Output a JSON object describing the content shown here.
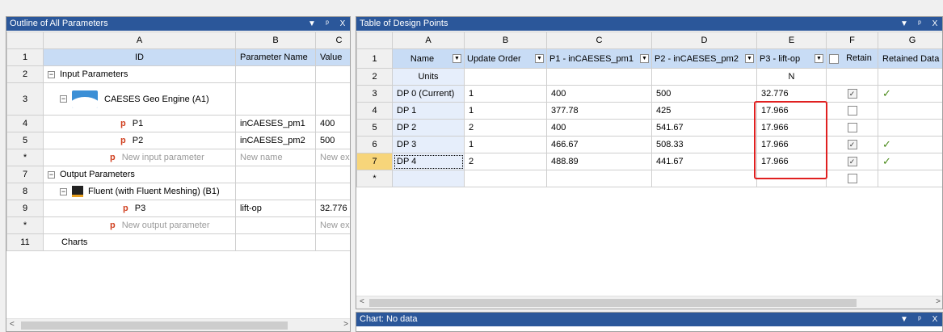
{
  "outline": {
    "title": "Outline of All Parameters",
    "col_letters": [
      "A",
      "B",
      "C"
    ],
    "headers": [
      "ID",
      "Parameter Name",
      "Value"
    ],
    "rows": [
      {
        "num": "2",
        "id": "Input Parameters",
        "name": "",
        "value": ""
      },
      {
        "num": "3",
        "id": "CAESES Geo Engine (A1)",
        "name": "",
        "value": ""
      },
      {
        "num": "4",
        "id": "P1",
        "name": "inCAESES_pm1",
        "value": "400"
      },
      {
        "num": "5",
        "id": "P2",
        "name": "inCAESES_pm2",
        "value": "500"
      },
      {
        "num": "*",
        "id": "New input parameter",
        "name": "New name",
        "value": "New expression"
      },
      {
        "num": "7",
        "id": "Output Parameters",
        "name": "",
        "value": ""
      },
      {
        "num": "8",
        "id": "Fluent (with Fluent Meshing) (B1)",
        "name": "",
        "value": ""
      },
      {
        "num": "9",
        "id": "P3",
        "name": "lift-op",
        "value": "32.776"
      },
      {
        "num": "*",
        "id": "New output parameter",
        "name": "",
        "value": "New expression"
      },
      {
        "num": "11",
        "id": "Charts",
        "name": "",
        "value": ""
      }
    ],
    "header_row_num": "1",
    "p_icon": "p"
  },
  "design_points": {
    "title": "Table of Design Points",
    "col_letters": [
      "A",
      "B",
      "C",
      "D",
      "E",
      "F",
      "G"
    ],
    "headers": [
      "Name",
      "Update Order",
      "P1 - inCAESES_pm1",
      "P2 - inCAESES_pm2",
      "P3 - lift-op",
      "Retain",
      "Retained Data"
    ],
    "units_label": "Units",
    "units_e": "N",
    "rows": [
      {
        "num": "3",
        "name": "DP 0 (Current)",
        "order": "1",
        "p1": "400",
        "p2": "500",
        "p3": "32.776",
        "retain": true,
        "data": true
      },
      {
        "num": "4",
        "name": "DP 1",
        "order": "1",
        "p1": "377.78",
        "p2": "425",
        "p3": "17.966",
        "retain": false,
        "data": false
      },
      {
        "num": "5",
        "name": "DP 2",
        "order": "2",
        "p1": "400",
        "p2": "541.67",
        "p3": "17.966",
        "retain": false,
        "data": false
      },
      {
        "num": "6",
        "name": "DP 3",
        "order": "1",
        "p1": "466.67",
        "p2": "508.33",
        "p3": "17.966",
        "retain": true,
        "data": true
      },
      {
        "num": "7",
        "name": "DP 4",
        "order": "2",
        "p1": "488.89",
        "p2": "441.67",
        "p3": "17.966",
        "retain": true,
        "data": true
      }
    ],
    "header_row_num": "1",
    "units_row_num": "2",
    "new_row_num": "*",
    "highlight_color": "#e02020"
  },
  "chart": {
    "title": "Chart: No data"
  },
  "icons": {
    "pin": "pin-icon",
    "close": "close-icon",
    "dropdown": "dropdown-icon"
  },
  "symbols": {
    "dropdown": "▼",
    "pin": "ᵖ",
    "close": "X",
    "checkmark": "✓",
    "minus": "−",
    "arrow_left": "<",
    "arrow_right": ">"
  }
}
